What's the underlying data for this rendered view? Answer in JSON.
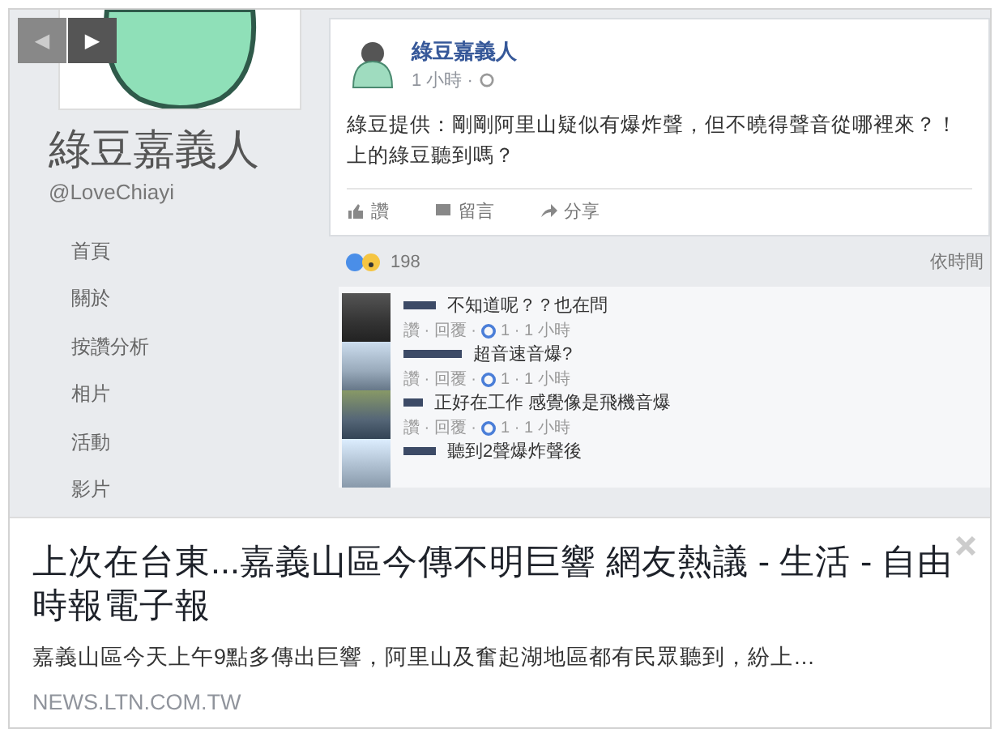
{
  "nav_arrows": [
    {
      "glyph": "◀",
      "disabled": true
    },
    {
      "glyph": "▶",
      "disabled": false
    }
  ],
  "preview": {
    "page_name": "綠豆嘉義人",
    "handle": "@LoveChiayi",
    "sidebar_items": [
      "首頁",
      "關於",
      "按讚分析",
      "相片",
      "活動",
      "影片"
    ],
    "post": {
      "author": "綠豆嘉義人",
      "time": "1 小時 ·",
      "text_lines": [
        "綠豆提供：剛剛阿里山疑似有爆炸聲，但不曉得聲音從哪裡來？！",
        "上的綠豆聽到嗎？"
      ],
      "actions": [
        "讚",
        "留言",
        "分享"
      ]
    },
    "reactions_count": "198",
    "sort_label": "依時間",
    "comments": [
      {
        "text": "不知道呢？？也在問",
        "meta": "讚 · 回覆 ·",
        "likes": "1 · 1 小時"
      },
      {
        "text": "超音速音爆?",
        "meta": "讚 · 回覆 ·",
        "likes": "1 · 1 小時"
      },
      {
        "text": "正好在工作 感覺像是飛機音爆",
        "meta": "讚 · 回覆 ·",
        "likes": "1 · 1 小時"
      },
      {
        "text": "聽到2聲爆炸聲後"
      }
    ]
  },
  "link": {
    "title": "上次在台東...嘉義山區今傳不明巨響 網友熱議 - 生活 - 自由時報電子報",
    "description": "嘉義山區今天上午9點多傳出巨響，阿里山及奮起湖地區都有民眾聽到，紛上…",
    "domain": "NEWS.LTN.COM.TW"
  }
}
